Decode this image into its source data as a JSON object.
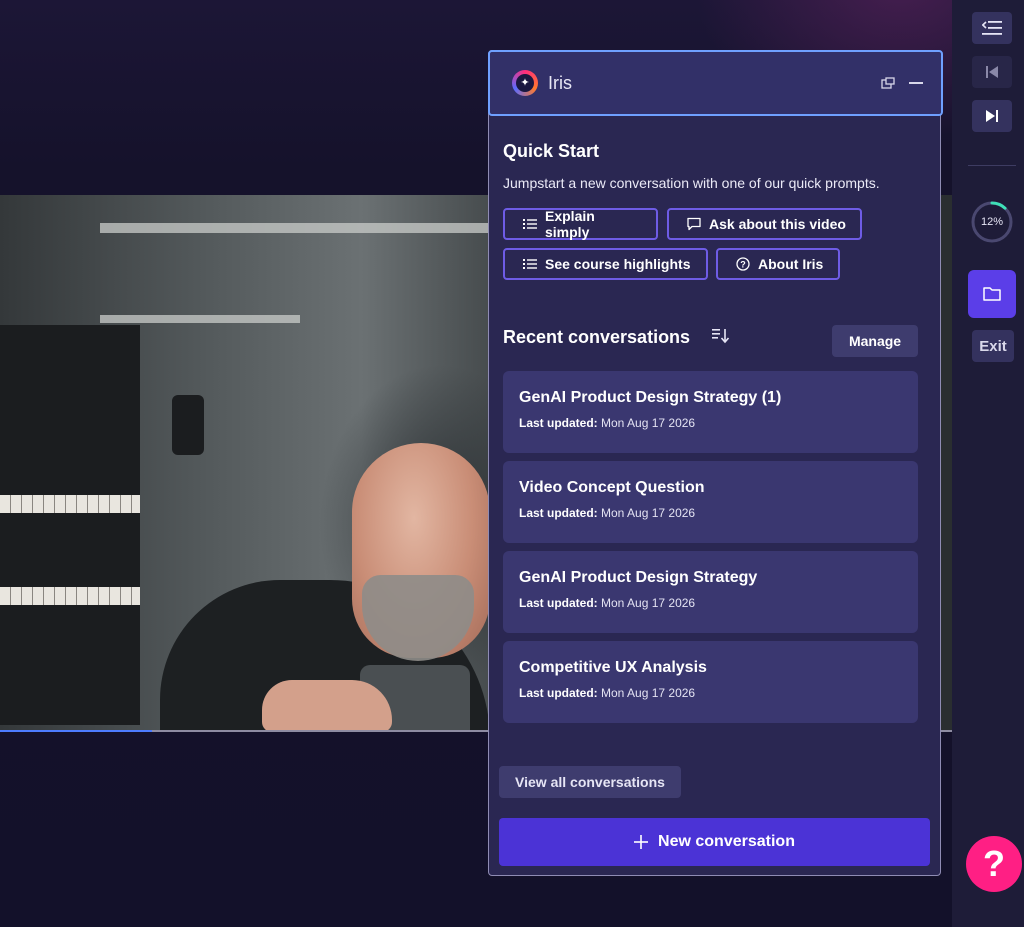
{
  "iris": {
    "title": "Iris",
    "quick_start": {
      "title": "Quick Start",
      "description": "Jumpstart a new conversation with one of our quick prompts.",
      "prompts": [
        {
          "label": "Explain simply",
          "icon": "list-icon"
        },
        {
          "label": "Ask about this video",
          "icon": "speech-bubble-icon"
        },
        {
          "label": "See course highlights",
          "icon": "list-icon"
        },
        {
          "label": "About Iris",
          "icon": "question-circle-icon"
        }
      ]
    },
    "recent": {
      "title": "Recent conversations",
      "manage_label": "Manage",
      "conversations": [
        {
          "title": "GenAI Product Design Strategy (1)",
          "updated_label": "Last updated:",
          "updated_value": "Mon Aug 17 2026"
        },
        {
          "title": "Video Concept Question",
          "updated_label": "Last updated:",
          "updated_value": "Mon Aug 17 2026"
        },
        {
          "title": "GenAI Product Design Strategy",
          "updated_label": "Last updated:",
          "updated_value": "Mon Aug 17 2026"
        },
        {
          "title": "Competitive UX Analysis",
          "updated_label": "Last updated:",
          "updated_value": "Mon Aug 17 2026"
        }
      ]
    },
    "view_all_label": "View all conversations",
    "new_conversation_label": "New conversation"
  },
  "sidebar": {
    "course_progress": "12%",
    "course_progress_fraction": 0.12,
    "exit_label": "Exit"
  },
  "help": {
    "label": "?"
  },
  "video": {
    "progress_fraction": 0.16
  },
  "colors": {
    "accent": "#4b33d6",
    "chip_border": "#6e5ce6",
    "help": "#ff1f84",
    "progress_ring": "#3fe0b8"
  }
}
